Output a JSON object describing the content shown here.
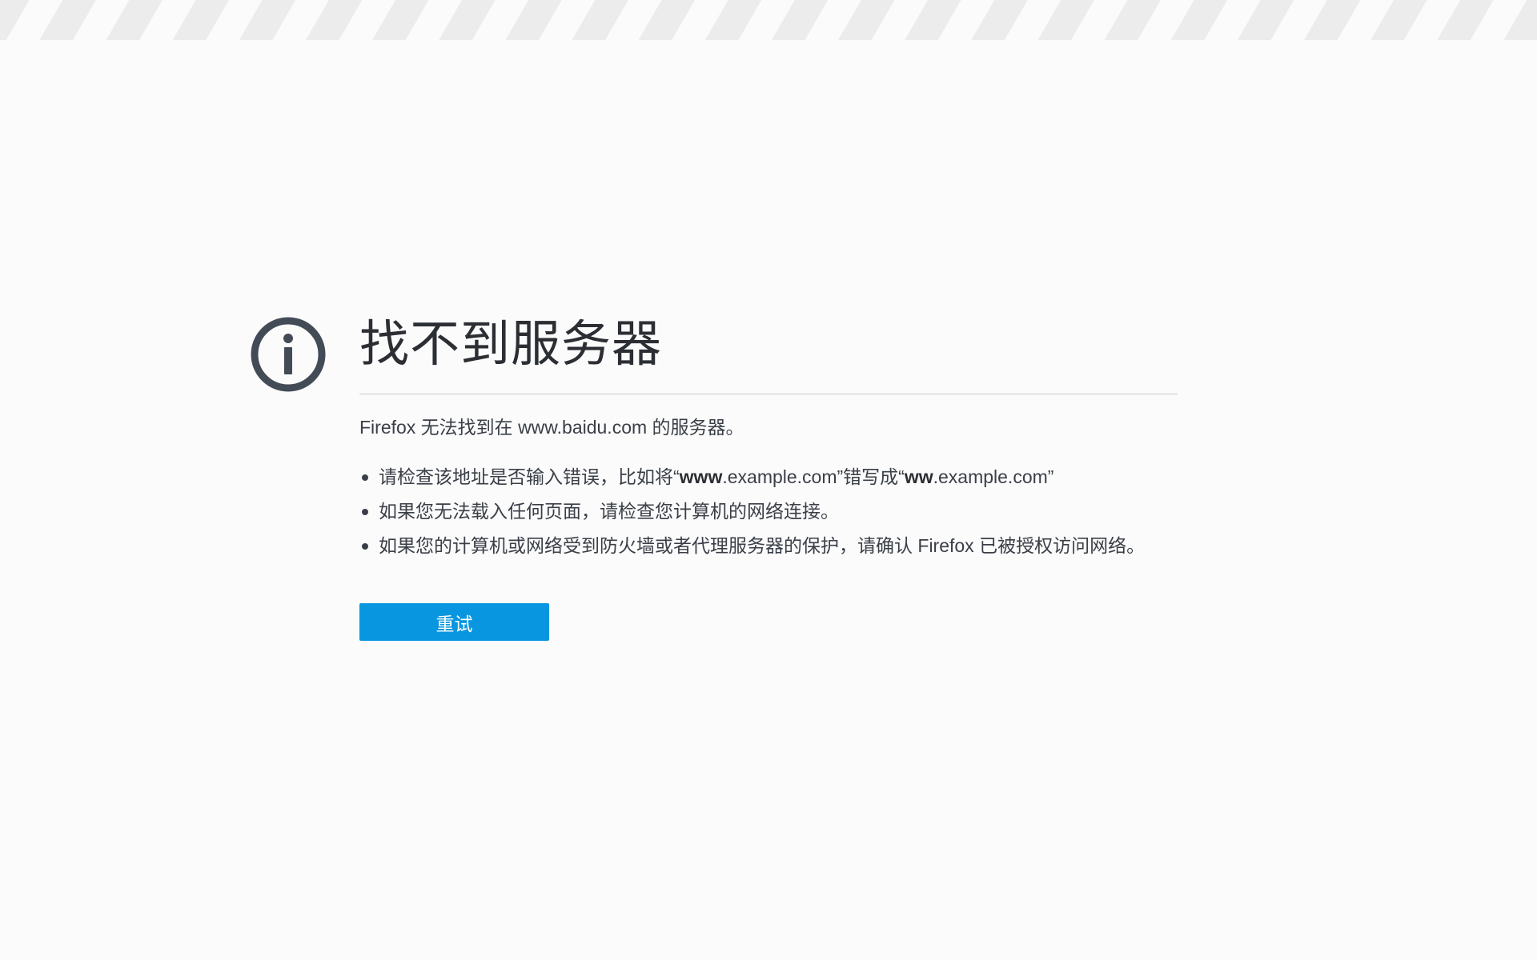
{
  "error_page": {
    "title": "找不到服务器",
    "description": "Firefox 无法找到在 www.baidu.com 的服务器。",
    "suggestions": {
      "item1": {
        "prefix": "请检查该地址是否输入错误，比如将“",
        "correct_bold": "www",
        "correct_rest": ".example.com”错写成“",
        "wrong_bold": "ww",
        "wrong_rest": ".example.com”"
      },
      "item2": "如果您无法载入任何页面，请检查您计算机的网络连接。",
      "item3": "如果您的计算机或网络受到防火墙或者代理服务器的保护，请确认 Firefox 已被授权访问网络。"
    },
    "retry_label": "重试",
    "icon": "info-icon",
    "colors": {
      "accent": "#0996e0",
      "icon": "#434b56",
      "background": "#fbfbfb"
    }
  }
}
